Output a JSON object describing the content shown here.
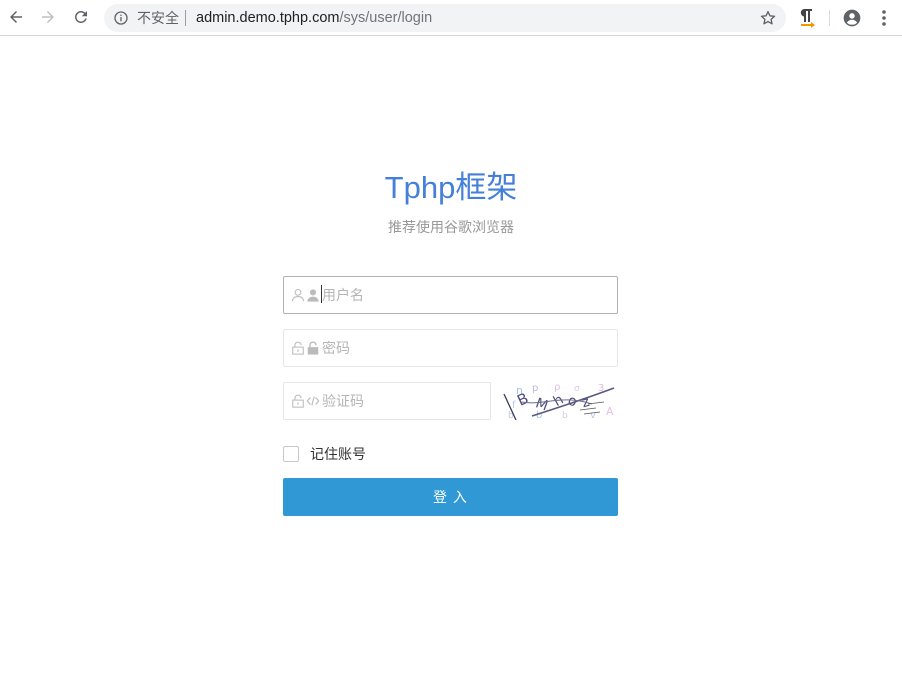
{
  "browser": {
    "security_label": "不安全",
    "url_host": "admin.demo.tphp.com",
    "url_path": "/sys/user/login"
  },
  "page": {
    "title": "Tphp框架",
    "subtitle": "推荐使用谷歌浏览器"
  },
  "form": {
    "username_placeholder": "用户名",
    "password_placeholder": "密码",
    "captcha_placeholder": "验证码",
    "remember_label": "记住账号",
    "remember_checked": false,
    "submit_label": "登 入"
  },
  "colors": {
    "title": "#4580d8",
    "button": "#2f98d5"
  },
  "icons": [
    "back-arrow-icon",
    "forward-arrow-icon",
    "reload-icon",
    "info-icon",
    "star-icon",
    "extension-icon",
    "account-icon",
    "menu-icon",
    "user-icon",
    "lock-icon",
    "code-icon"
  ]
}
